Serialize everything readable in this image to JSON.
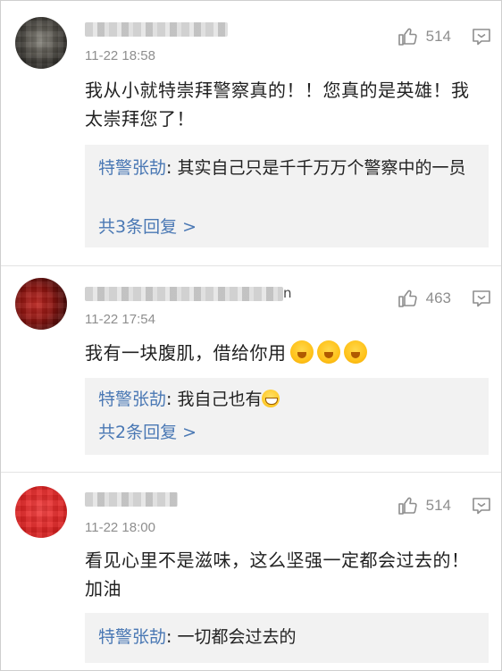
{
  "comments": [
    {
      "username_tail": "",
      "time": "11-22 18:58",
      "likes": "514",
      "text": "我从小就特崇拜警察真的！！您真的是英雄！我太崇拜您了！",
      "reply": {
        "author": "特警张劼",
        "text": ": 其实自己只是千千万万个警察中的一员"
      },
      "more_replies": "共3条回复 >"
    },
    {
      "username_tail": "n",
      "time": "11-22 17:54",
      "likes": "463",
      "text": "我有一块腹肌，借给你用",
      "reply": {
        "author": "特警张劼",
        "text": ": 我自己也有"
      },
      "more_replies": "共2条回复 >"
    },
    {
      "username_tail": "",
      "time": "11-22 18:00",
      "likes": "514",
      "text": "看见心里不是滋味，这么坚强一定都会过去的！加油",
      "reply": {
        "author": "特警张劼",
        "text": ": 一切都会过去的"
      }
    }
  ],
  "icons": {
    "like": "thumbs-up-icon",
    "reply": "comment-bubble-icon",
    "laugh_emoji": "laughing-emoji-icon",
    "grin_emoji": "grinning-emoji-icon"
  },
  "colors": {
    "link": "#4a78b4",
    "meta": "#8e8e8e",
    "reply_bg": "#f2f2f2"
  }
}
